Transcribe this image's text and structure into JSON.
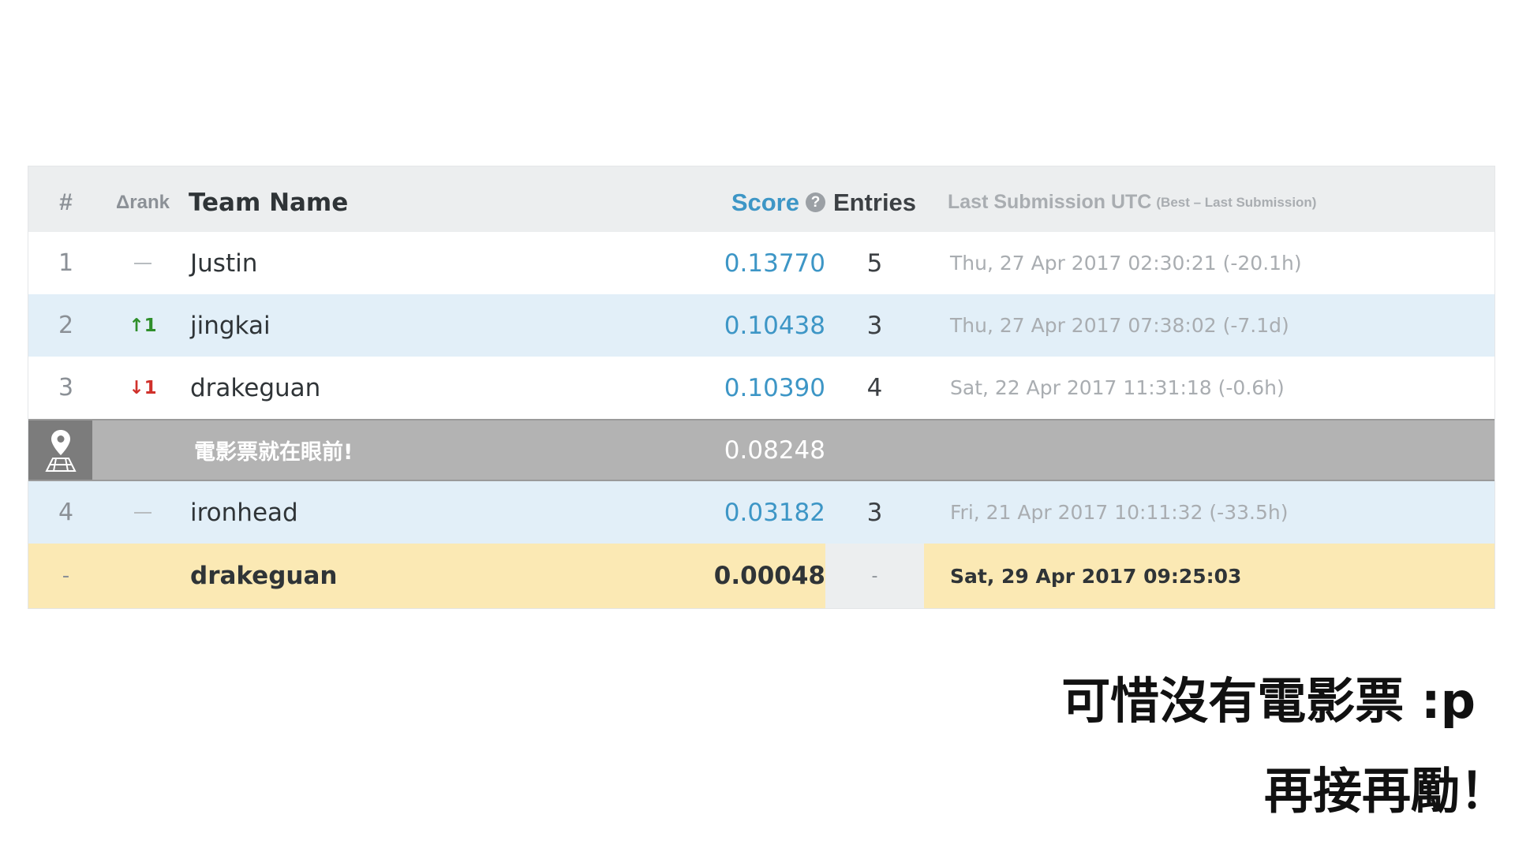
{
  "header": {
    "rank": "#",
    "delta": "Δrank",
    "team": "Team Name",
    "score": "Score",
    "score_help": "?",
    "entries": "Entries",
    "last": "Last Submission UTC",
    "last_sub": "(Best – Last Submission)"
  },
  "rows": [
    {
      "rank": "1",
      "delta": "—",
      "delta_dir": "none",
      "team": "Justin",
      "score": "0.13770",
      "entries": "5",
      "last": "Thu, 27 Apr 2017 02:30:21 (-20.1h)"
    },
    {
      "rank": "2",
      "delta": "↑1",
      "delta_dir": "up",
      "team": "jingkai",
      "score": "0.10438",
      "entries": "3",
      "last": "Thu, 27 Apr 2017 07:38:02 (-7.1d)"
    },
    {
      "rank": "3",
      "delta": "↓1",
      "delta_dir": "down",
      "team": "drakeguan",
      "score": "0.10390",
      "entries": "4",
      "last": "Sat, 22 Apr 2017 11:31:18 (-0.6h)"
    },
    {
      "rank": "4",
      "delta": "—",
      "delta_dir": "none",
      "team": "ironhead",
      "score": "0.03182",
      "entries": "3",
      "last": "Fri, 21 Apr 2017 10:11:32 (-33.5h)"
    }
  ],
  "benchmark": {
    "label": "電影票就在眼前!",
    "score": "0.08248",
    "icon": "map-pin-icon"
  },
  "my_entry": {
    "rank": "-",
    "team": "drakeguan",
    "score": "0.00048",
    "entries": "-",
    "last": "Sat, 29 Apr 2017 09:25:03"
  },
  "notes": {
    "line1": "可惜沒有電影票 :p",
    "line2": "再接再勵！"
  },
  "colors": {
    "score_link": "#3d96c6",
    "up": "#2f8f2b",
    "down": "#d0312b",
    "highlight": "#fbe9b4",
    "alt_row": "#e2eff8"
  }
}
